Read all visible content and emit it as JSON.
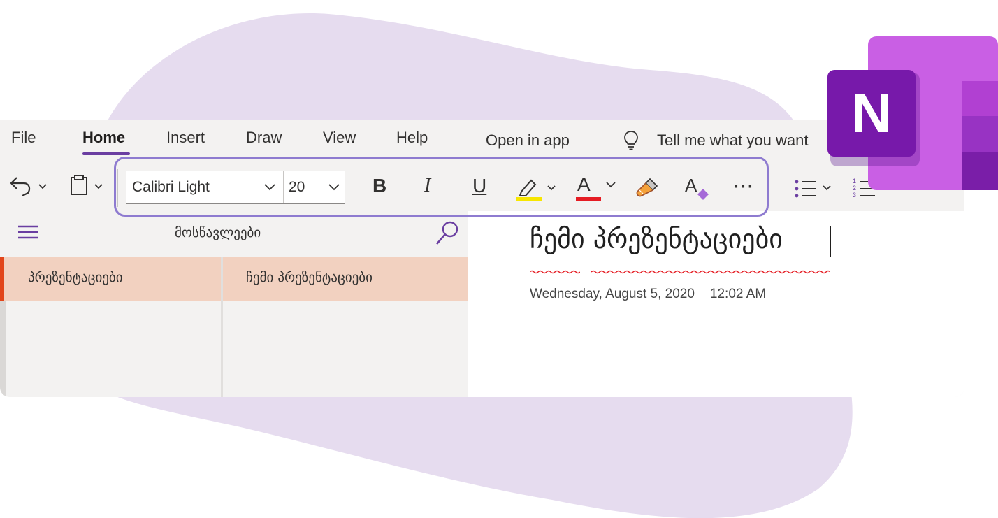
{
  "menu": {
    "file": "File",
    "home": "Home",
    "insert": "Insert",
    "draw": "Draw",
    "view": "View",
    "help": "Help",
    "open_in_app": "Open in app",
    "tell_me": "Tell me what you want"
  },
  "toolbar": {
    "font_name": "Calibri Light",
    "font_size": "20",
    "bold": "B",
    "italic": "I",
    "underline": "U",
    "font_color": "A",
    "clear_format": "A",
    "more": "···",
    "highlight_color": "#f7e600",
    "font_color_bar": "#e51c23"
  },
  "nav": {
    "notebook_title": "მოსწავლეები",
    "section_label": "პრეზენტაციები",
    "page_label": "ჩემი პრეზენტაციები"
  },
  "page": {
    "title": "ჩემი პრეზენტაციები",
    "date": "Wednesday, August 5, 2020",
    "time": "12:02 AM"
  },
  "logo": {
    "letter": "N"
  },
  "colors": {
    "accent": "#6a3ea1",
    "section_bg": "#f2d1c0",
    "section_marker": "#e2451a",
    "highlight_box": "#8e7bd0"
  }
}
